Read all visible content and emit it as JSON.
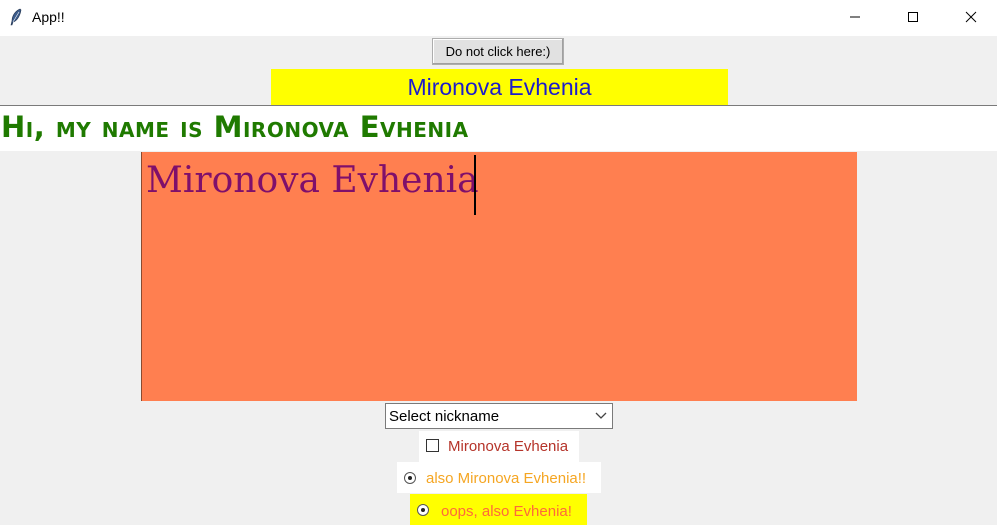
{
  "window": {
    "title": "App!!",
    "icon": "feather-icon",
    "controls": [
      "minimize-icon",
      "maximize-icon",
      "close-icon"
    ]
  },
  "top_button": {
    "label": "Do not click here:)"
  },
  "name_label": {
    "text": "Mironova Evhenia",
    "background": "#ffff00",
    "color": "#1c1ccc"
  },
  "entry": {
    "value": "Hi, my name is Mironova Evhenia",
    "color": "#1f7a00"
  },
  "text_area": {
    "value": "Mironova Evhenia",
    "background": "#ff7f50",
    "color": "#7f0f6b"
  },
  "nickname_select": {
    "selected": "Select nickname",
    "icon": "chevron-down-icon"
  },
  "checkbox": {
    "label": "Mironova Evhenia",
    "checked": false,
    "color": "#b5342a"
  },
  "radios": [
    {
      "label": "also Mironova Evhenia!!",
      "color": "#f5a623",
      "background": "#ffffff"
    },
    {
      "label": "oops, also Evhenia!",
      "color": "#ff6a3a",
      "background": "#ffff00"
    }
  ]
}
